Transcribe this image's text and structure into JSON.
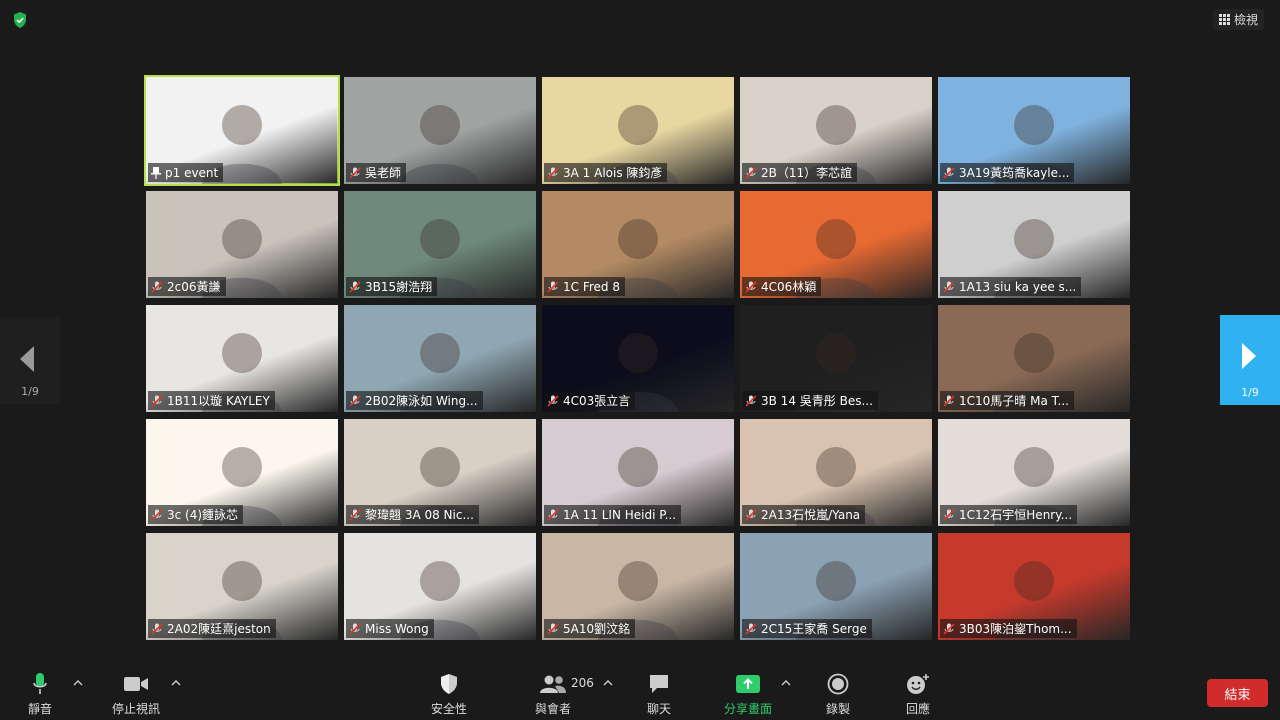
{
  "top": {
    "view_label": "檢視"
  },
  "navigation": {
    "prev_page": "1/9",
    "next_page": "1/9"
  },
  "participants": [
    {
      "name": "p1 event",
      "pinned": true,
      "active": true,
      "bg": "#f2f2f2"
    },
    {
      "name": "吳老師",
      "bg": "#9fa3a2"
    },
    {
      "name": "3A 1 Alois 陳鈞彥",
      "bg": "#e9d7a2"
    },
    {
      "name": "2B（11）李芯誼",
      "bg": "#d9d2c9"
    },
    {
      "name": "3A19黃筠喬kayle...",
      "bg": "#7fb2de"
    },
    {
      "name": "2c06黃謙",
      "bg": "#c9c3bc"
    },
    {
      "name": "3B15謝浩翔",
      "bg": "#6f8a7d"
    },
    {
      "name": "1C Fred 8",
      "bg": "#b38a63"
    },
    {
      "name": "4C06林穎",
      "bg": "#e86a33"
    },
    {
      "name": "1A13 siu ka yee s...",
      "bg": "#cfcfcf"
    },
    {
      "name": "1B11以璇 KAYLEY",
      "bg": "#e8e6e3"
    },
    {
      "name": "2B02陳泳如 Wing...",
      "bg": "#8fa7b3"
    },
    {
      "name": "4C03張立言",
      "bg": "#0c0c1d"
    },
    {
      "name": "3B 14 吳青彤 Bes...",
      "bg": "#1f1f1f"
    },
    {
      "name": "1C10馬子晴 Ma T...",
      "bg": "#8a6a55"
    },
    {
      "name": "3c (4)鍾詠芯",
      "bg": "#fbf7ee"
    },
    {
      "name": "黎瑋翹 3A 08 Nic...",
      "bg": "#d8d0c5"
    },
    {
      "name": "1A 11 LIN Heidi P...",
      "bg": "#d7cbd1"
    },
    {
      "name": "2A13石悅嵐/Yana",
      "bg": "#d9c3b0"
    },
    {
      "name": "1C12石宇恒Henry...",
      "bg": "#e2ddd9"
    },
    {
      "name": "2A02陳廷熹jeston",
      "bg": "#d8d4cc"
    },
    {
      "name": "Miss Wong",
      "bg": "#e5e3e0"
    },
    {
      "name": "5A10劉汶銘",
      "bg": "#c9b7a5"
    },
    {
      "name": "2C15王家喬 Serge",
      "bg": "#8ba1b4"
    },
    {
      "name": "3B03陳泊鋆Thom...",
      "bg": "#c63a2c"
    }
  ],
  "toolbar": {
    "mute": "靜音",
    "stop_video": "停止視訊",
    "security": "安全性",
    "participants": "與會者",
    "participant_count": "206",
    "chat": "聊天",
    "share_screen": "分享畫面",
    "record": "錄製",
    "reactions": "回應",
    "end": "結束"
  },
  "colors": {
    "accent_green": "#2fcc6b",
    "active_border": "#b6e04a",
    "nav_blue": "#2fb1f2",
    "end_red": "#d12b2b"
  }
}
